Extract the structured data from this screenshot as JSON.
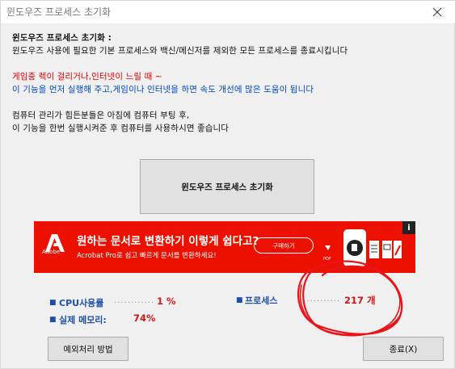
{
  "window": {
    "title": "윈도우즈 프로세스 초기화"
  },
  "intro": {
    "heading": "윈도우즈 프로세스 초기화 :",
    "desc": "윈도우즈 사용에 필요한 기본 프로세스와 백신/메신저를 제외한 모든 프로세스를 종료시킵니다"
  },
  "game": {
    "heading": "게임중 렉이 걸리거나,인터넷이 느릴 때 ~",
    "desc": "이 기능을 먼저 실행해 주고,게임이나 인터넷을 하면 속도 개선에 많은 도움이 됩니다"
  },
  "tip": {
    "line1": "컴퓨터 관리가 힘든분들은 아침에 컴퓨터 부팅 후,",
    "line2": "이 기능을 한번 실행시켜준 후 컴퓨터를 사용하시면 좋습니다"
  },
  "main_button": {
    "label": "윈도우즈 프로세스 초기화"
  },
  "ad": {
    "brand": "Adobe",
    "headline": "원하는 문서로 변환하기 이렇게 쉽다고?",
    "subline": "Acrobat Pro로 쉽고 빠르게 문서를 변환하세요!",
    "buy_label": "구매하기",
    "info": "i",
    "pdf_label": "PDF"
  },
  "stats": {
    "cpu_label": "CPU사용률",
    "cpu_value": "1 %",
    "mem_label": "실제 메모리:",
    "mem_value": "74%",
    "proc_label": "프로세스",
    "proc_value": "217 개",
    "bullet": "■",
    "dots": "............"
  },
  "buttons": {
    "exceptions": "예외처리 방법",
    "exit": "종료(X)"
  },
  "colors": {
    "ad_red": "#eb1000",
    "stat_blue": "#1f4fa8",
    "stat_red": "#d01818"
  }
}
